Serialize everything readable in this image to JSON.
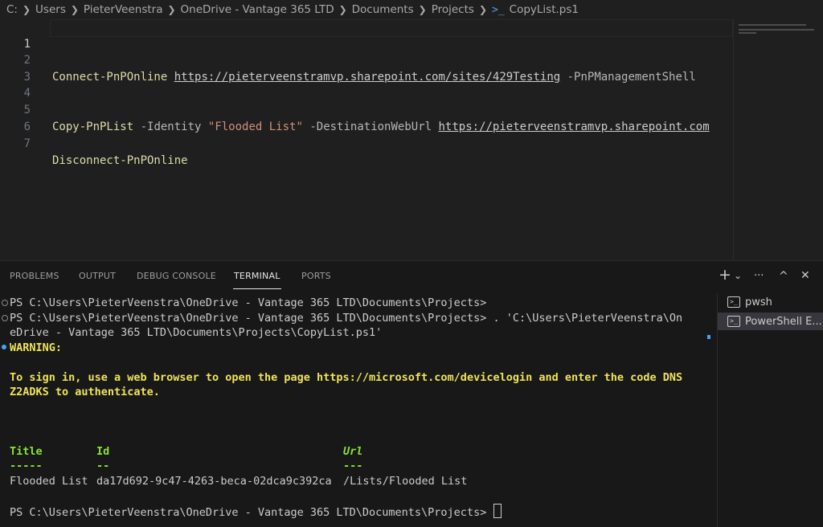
{
  "breadcrumb": {
    "parts": [
      "C:",
      "Users",
      "PieterVeenstra",
      "OneDrive - Vantage 365 LTD",
      "Documents",
      "Projects"
    ],
    "file": "CopyList.ps1",
    "separator": ">"
  },
  "editor": {
    "line_numbers": [
      "1",
      "2",
      "3",
      "4",
      "5",
      "6",
      "7"
    ],
    "line2": {
      "cmd": "Connect-PnPOnline",
      "url": "https://pieterveenstramvp.sharepoint.com/sites/429Testing",
      "param": "-PnPManagementShell"
    },
    "line5": {
      "cmd": "Copy-PnPList",
      "param1": "-Identity",
      "str": "\"Flooded List\"",
      "param2": "-DestinationWebUrl",
      "url": "https://pieterveenstramvp.sharepoint.com"
    },
    "line7": {
      "cmd": "Disconnect-PnPOnline"
    }
  },
  "panel": {
    "tabs": [
      "PROBLEMS",
      "OUTPUT",
      "DEBUG CONSOLE",
      "TERMINAL",
      "PORTS"
    ],
    "actions": {
      "add": "+",
      "chevron": "⌄",
      "more": "···",
      "maximize": "^",
      "close": "✕"
    }
  },
  "terminal": {
    "line1": "PS C:\\Users\\PieterVeenstra\\OneDrive - Vantage 365 LTD\\Documents\\Projects>",
    "line2": "PS C:\\Users\\PieterVeenstra\\OneDrive - Vantage 365 LTD\\Documents\\Projects> . 'C:\\Users\\PieterVeenstra\\On",
    "line3": "eDrive - Vantage 365 LTD\\Documents\\Projects\\CopyList.ps1'",
    "warning": "WARNING:",
    "signin1": "To sign in, use a web browser to open the page https://microsoft.com/devicelogin and enter the code DNS",
    "signin2": "Z2ADKS to authenticate.",
    "table": {
      "headers": [
        "Title",
        "Id",
        "Url"
      ],
      "dashes": [
        "-----",
        "--",
        "---"
      ],
      "row": [
        "Flooded List",
        "da17d692-9c47-4263-beca-02dca9c392ca",
        "/Lists/Flooded List"
      ]
    },
    "prompt": "PS C:\\Users\\PieterVeenstra\\OneDrive - Vantage 365 LTD\\Documents\\Projects>"
  },
  "terminal_list": [
    "pwsh",
    "PowerShell E..."
  ],
  "colors": {
    "accent": "#4aa3f0",
    "warning": "#f0e35b",
    "header": "#8ae234"
  }
}
